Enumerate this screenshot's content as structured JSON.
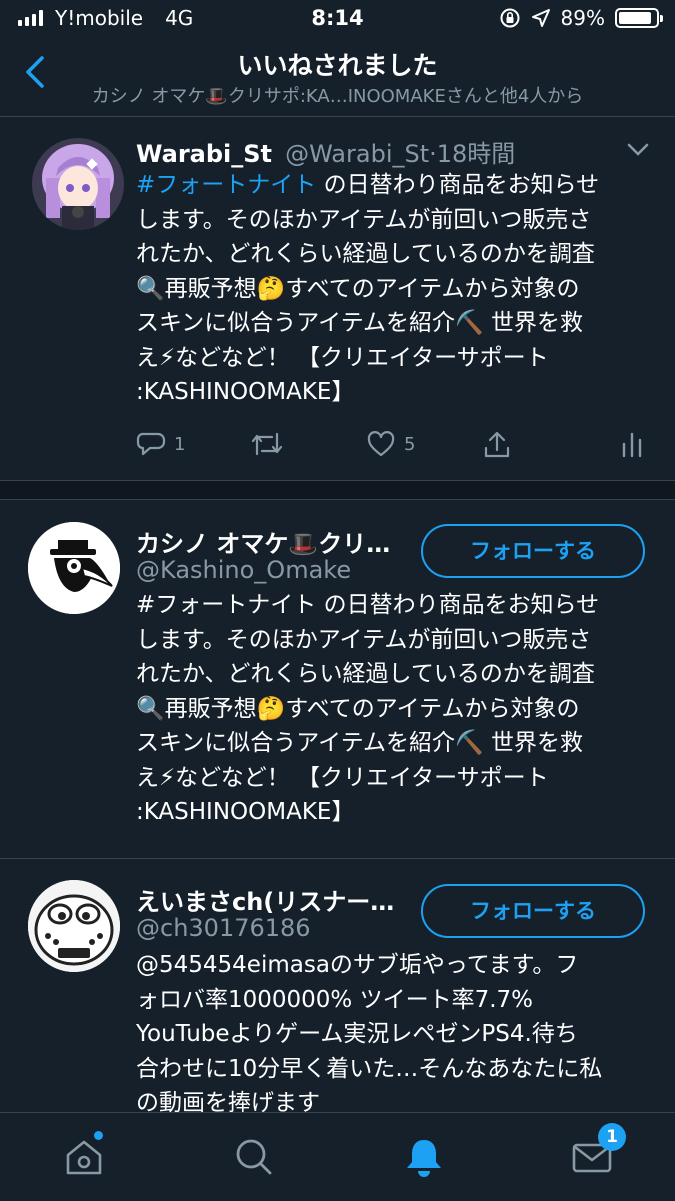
{
  "status_bar": {
    "carrier": "Y!mobile",
    "network": "4G",
    "time": "8:14",
    "battery": "89%",
    "battery_level": 0.89
  },
  "header": {
    "title": "いいねされました",
    "subtitle": "カシノ オマケ🎩クリサポ:KA…INOOMAKEさんと他4人から"
  },
  "tweet": {
    "name": "Warabi_St",
    "handle": "@Warabi_St",
    "time": "·18時間",
    "hashtag": "#フォートナイト",
    "lines": [
      " の日替わり商品をお知らせ",
      "します。そのほかアイテムが前回いつ販売さ",
      "れたか、どれくらい経過しているのかを調査",
      "🔍再販予想🤔すべてのアイテムから対象の",
      "スキンに似合うアイテムを紹介⛏️ 世界を救",
      "え⚡などなど！ 【クリエイターサポート",
      ":KASHINOOMAKE】"
    ],
    "replies": "1",
    "likes": "5"
  },
  "users": [
    {
      "name": "カシノ オマケ🎩クリ…",
      "handle": "@Kashino_Omake",
      "follow_label": "フォローする",
      "bio": [
        "#フォートナイト の日替わり商品をお知らせ",
        "します。そのほかアイテムが前回いつ販売さ",
        "れたか、どれくらい経過しているのかを調査",
        "🔍再販予想🤔すべてのアイテムから対象の",
        "スキンに似合うアイテムを紹介⛏️ 世界を救",
        "え⚡などなど！ 【クリエイターサポート",
        ":KASHINOOMAKE】"
      ]
    },
    {
      "name": "えいまさch(リスナー…",
      "handle": "@ch30176186",
      "follow_label": "フォローする",
      "bio": [
        "@545454eimasaのサブ垢やってます。フ",
        "ォロバ率1000000% ツイート率7.7%",
        "YouTubeよりゲーム実況レペゼンPS4.待ち",
        "合わせに10分早く着いた…そんなあなたに私",
        "の動画を捧げます"
      ]
    }
  ],
  "tabbar": {
    "messages_badge": "1"
  },
  "colors": {
    "background": "#15202b",
    "accent": "#1da1f2",
    "secondary_text": "#8899a6",
    "divider": "#38444d"
  }
}
